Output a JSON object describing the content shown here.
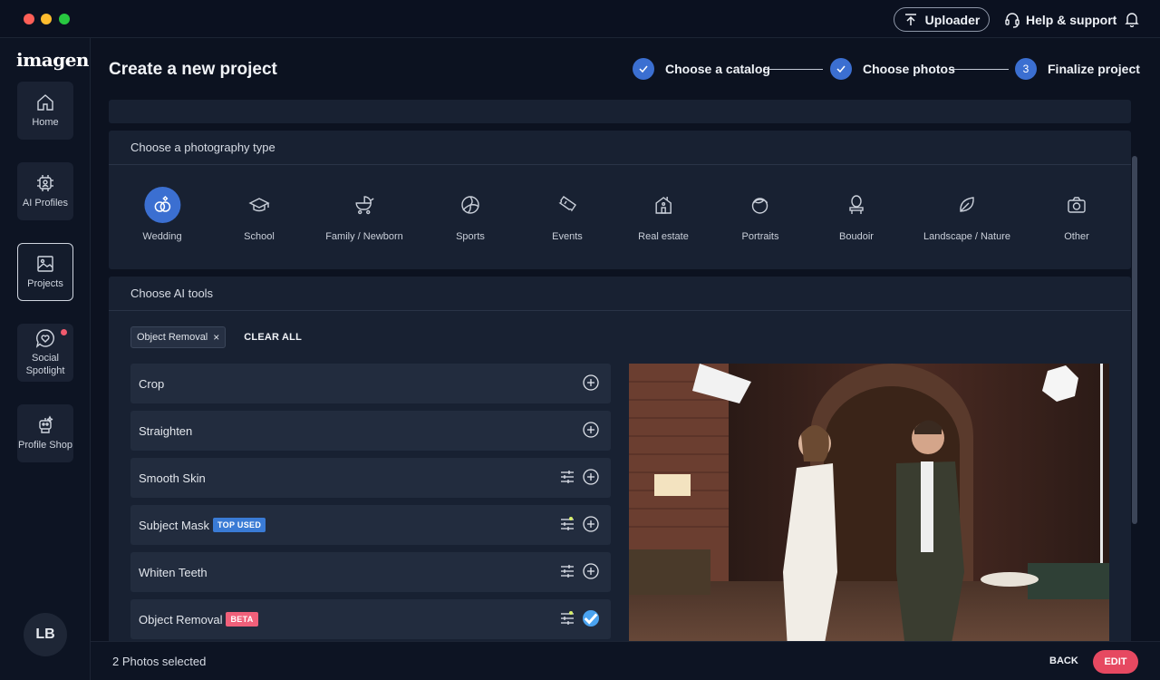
{
  "titlebar": {
    "uploader_label": "Uploader",
    "help_label": "Help & support"
  },
  "sidebar": {
    "logo": "imagen",
    "items": [
      {
        "label": "Home"
      },
      {
        "label": "AI Profiles"
      },
      {
        "label": "Projects"
      },
      {
        "label": "Social Spotlight"
      },
      {
        "label": "Profile Shop"
      }
    ],
    "avatar_initials": "LB"
  },
  "header": {
    "title": "Create a new project",
    "steps": [
      {
        "label": "Choose a catalog",
        "state": "done"
      },
      {
        "label": "Choose photos",
        "state": "done"
      },
      {
        "label": "Finalize project",
        "number": "3",
        "state": "current"
      }
    ]
  },
  "photography_type": {
    "heading": "Choose a photography type",
    "selected": "Wedding",
    "types": [
      "Wedding",
      "School",
      "Family / Newborn",
      "Sports",
      "Events",
      "Real estate",
      "Portraits",
      "Boudoir",
      "Landscape / Nature",
      "Other"
    ]
  },
  "ai_tools": {
    "heading": "Choose AI tools",
    "chips": [
      {
        "label": "Object Removal",
        "remove": "×"
      }
    ],
    "clear_all": "CLEAR ALL",
    "tools": [
      {
        "name": "Crop",
        "badge": "",
        "adjustable": false,
        "selected": false
      },
      {
        "name": "Straighten",
        "badge": "",
        "adjustable": false,
        "selected": false
      },
      {
        "name": "Smooth Skin",
        "badge": "",
        "adjustable": true,
        "selected": false
      },
      {
        "name": "Subject Mask",
        "badge": "TOP USED",
        "adjustable": true,
        "selected": false
      },
      {
        "name": "Whiten Teeth",
        "badge": "",
        "adjustable": true,
        "selected": false
      },
      {
        "name": "Object Removal",
        "badge": "BETA",
        "adjustable": true,
        "selected": true
      }
    ]
  },
  "footer": {
    "selected_text": "2 Photos selected",
    "back_label": "BACK",
    "edit_label": "EDIT"
  },
  "colors": {
    "accent_blue": "#3b6fd1",
    "edit_pink": "#e64961",
    "background": "#0c1220",
    "panel": "#182132"
  }
}
